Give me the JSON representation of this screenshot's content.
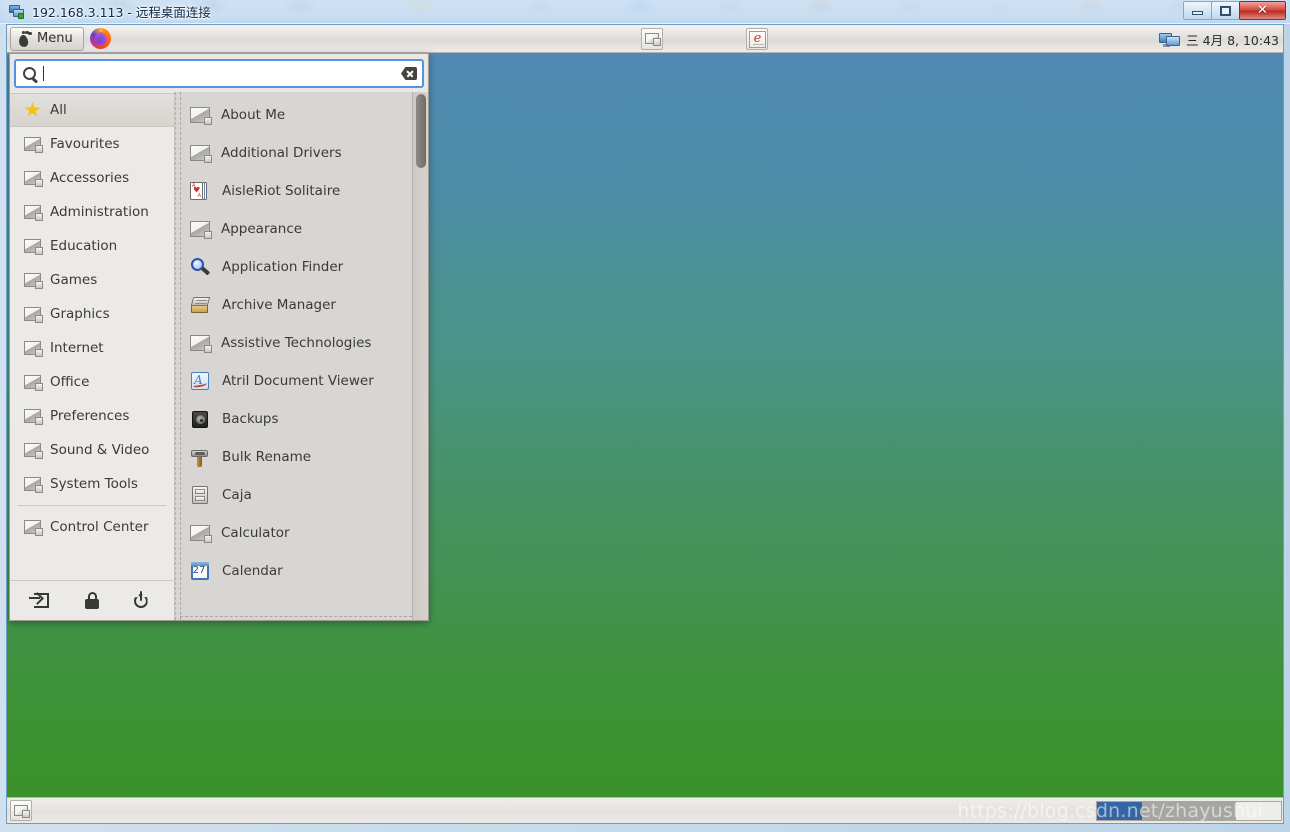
{
  "rdp": {
    "title": "192.168.3.113 - 远程桌面连接",
    "icon": "remote-desktop-icon",
    "controls": {
      "minimize": "—",
      "restore": "❐",
      "close": "✕"
    }
  },
  "top_panel": {
    "menu_button": {
      "label": "Menu",
      "icon": "mate-footprint-icon"
    },
    "launchers": [
      {
        "name": "firefox",
        "icon": "firefox-icon"
      }
    ],
    "tasks": [
      {
        "name": "window-task-1",
        "icon": "window-icon"
      },
      {
        "name": "window-task-2",
        "icon": "document-e-icon"
      }
    ],
    "tray": {
      "network_icon": "network-monitor-icon",
      "clock": "三 4月  8, 10:43"
    }
  },
  "menu": {
    "search": {
      "value": "",
      "placeholder": "",
      "icon": "search-icon",
      "clear_icon": "clear-icon"
    },
    "categories": [
      {
        "label": "All",
        "icon": "star-icon",
        "active": true
      },
      {
        "label": "Favourites",
        "icon": "placeholder-icon",
        "active": false
      },
      {
        "label": "Accessories",
        "icon": "placeholder-icon",
        "active": false
      },
      {
        "label": "Administration",
        "icon": "placeholder-icon",
        "active": false
      },
      {
        "label": "Education",
        "icon": "placeholder-icon",
        "active": false
      },
      {
        "label": "Games",
        "icon": "placeholder-icon",
        "active": false
      },
      {
        "label": "Graphics",
        "icon": "placeholder-icon",
        "active": false
      },
      {
        "label": "Internet",
        "icon": "placeholder-icon",
        "active": false
      },
      {
        "label": "Office",
        "icon": "placeholder-icon",
        "active": false
      },
      {
        "label": "Preferences",
        "icon": "placeholder-icon",
        "active": false
      },
      {
        "label": "Sound & Video",
        "icon": "placeholder-icon",
        "active": false
      },
      {
        "label": "System Tools",
        "icon": "placeholder-icon",
        "active": false
      }
    ],
    "control_center": {
      "label": "Control Center",
      "icon": "placeholder-icon"
    },
    "session_actions": [
      {
        "name": "logout",
        "icon": "logout-icon"
      },
      {
        "name": "lock-screen",
        "icon": "lock-icon"
      },
      {
        "name": "shutdown",
        "icon": "power-icon"
      }
    ],
    "applications": [
      {
        "label": "About Me",
        "icon": "placeholder-icon"
      },
      {
        "label": "Additional Drivers",
        "icon": "placeholder-icon"
      },
      {
        "label": "AisleRiot Solitaire",
        "icon": "playing-cards-icon"
      },
      {
        "label": "Appearance",
        "icon": "placeholder-icon"
      },
      {
        "label": "Application Finder",
        "icon": "magnifier-icon"
      },
      {
        "label": "Archive Manager",
        "icon": "archive-box-icon"
      },
      {
        "label": "Assistive Technologies",
        "icon": "placeholder-icon"
      },
      {
        "label": "Atril Document Viewer",
        "icon": "atril-document-icon"
      },
      {
        "label": "Backups",
        "icon": "safe-icon"
      },
      {
        "label": "Bulk Rename",
        "icon": "hammer-icon"
      },
      {
        "label": "Caja",
        "icon": "file-cabinet-icon"
      },
      {
        "label": "Calculator",
        "icon": "placeholder-icon"
      },
      {
        "label": "Calendar",
        "icon": "calendar-icon",
        "day": "27"
      }
    ]
  },
  "bottom_panel": {
    "show_desktop": {
      "name": "show-desktop",
      "icon": "window-icon"
    },
    "workspaces": [
      {
        "name": "workspace-1",
        "active": true
      },
      {
        "name": "workspace-2",
        "active": false
      },
      {
        "name": "workspace-3",
        "active": false
      },
      {
        "name": "workspace-4",
        "active": false
      }
    ]
  },
  "watermark": "https://blog.csdn.net/zhayushui",
  "colors": {
    "desktop_top": "#5289b5",
    "desktop_bottom": "#389128",
    "accent": "#5294e2",
    "workspace_active": "#3465a4",
    "close_button": "#bb2a20"
  }
}
